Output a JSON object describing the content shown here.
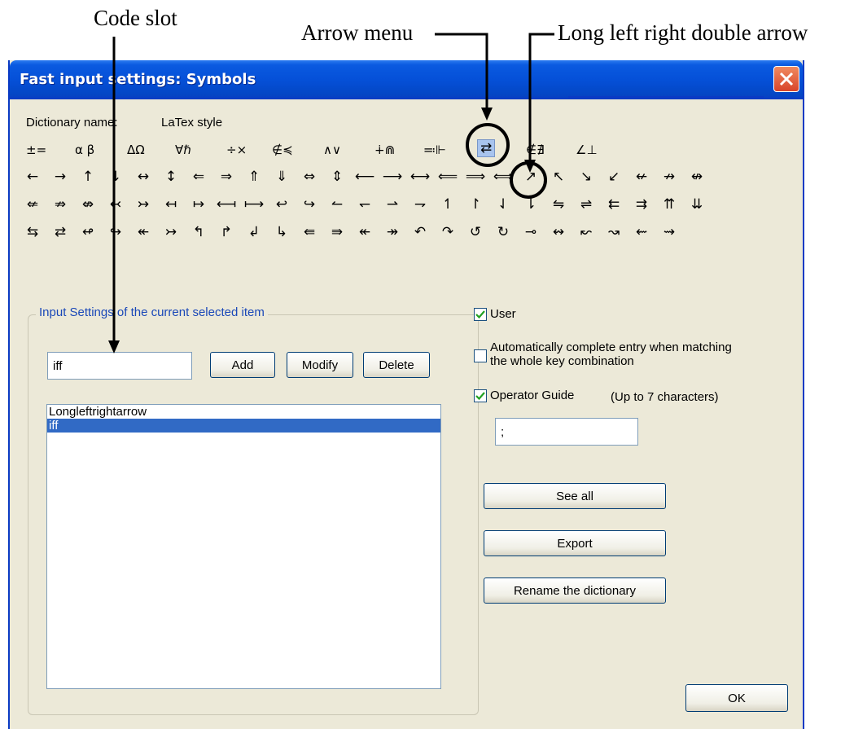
{
  "annotations": {
    "code_slot": "Code slot",
    "arrow_menu": "Arrow menu",
    "long_arrow": "Long left right double arrow"
  },
  "window": {
    "title": "Fast input settings: Symbols"
  },
  "dictionary": {
    "label": "Dictionary name:",
    "value": "LaTex style"
  },
  "tabs": [
    "±=",
    "α β",
    "ΔΩ",
    "∀ℏ",
    "÷×",
    "∉≼",
    "∧∨",
    "∔⋒",
    "≕⊩",
    "⇄",
    "∉∄",
    "∠⊥"
  ],
  "symbol_rows": [
    [
      "←",
      "→",
      "↑",
      "↓",
      "↔",
      "↕",
      "⇐",
      "⇒",
      "⇑",
      "⇓",
      "⇔",
      "⇕",
      "⟵",
      "⟶",
      "⟷",
      "⟸",
      "⟹",
      "⟺",
      "↗",
      "↖",
      "↘",
      "↙",
      "↚",
      "↛",
      "↮"
    ],
    [
      "⇍",
      "⇏",
      "⇎",
      "↢",
      "↣",
      "↤",
      "↦",
      "⟻",
      "⟼",
      "↩",
      "↪",
      "↼",
      "↽",
      "⇀",
      "⇁",
      "↿",
      "↾",
      "⇃",
      "⇂",
      "⇋",
      "⇌",
      "⇇",
      "⇉",
      "⇈",
      "⇊"
    ],
    [
      "⇆",
      "⇄",
      "↫",
      "↬",
      "↞",
      "↣",
      "↰",
      "↱",
      "↲",
      "↳",
      "⇚",
      "⇛",
      "↞",
      "↠",
      "↶",
      "↷",
      "↺",
      "↻",
      "⊸",
      "↭",
      "↜",
      "↝",
      "⇜",
      "⇝"
    ]
  ],
  "group": {
    "label": "Input Settings of the current selected item",
    "code_value": "iff",
    "add_label": "Add",
    "modify_label": "Modify",
    "delete_label": "Delete",
    "list_items": [
      "Longleftrightarrow",
      "iff"
    ]
  },
  "options": {
    "user_label": "User",
    "user_checked": true,
    "auto_label_1": "Automatically complete entry when matching",
    "auto_label_2": "the whole key combination",
    "auto_checked": false,
    "guide_label": "Operator Guide",
    "guide_checked": true,
    "guide_hint": "(Up to 7 characters)",
    "guide_value": ";"
  },
  "buttons": {
    "see_all": "See all",
    "export": "Export",
    "rename": "Rename the dictionary",
    "ok": "OK"
  }
}
